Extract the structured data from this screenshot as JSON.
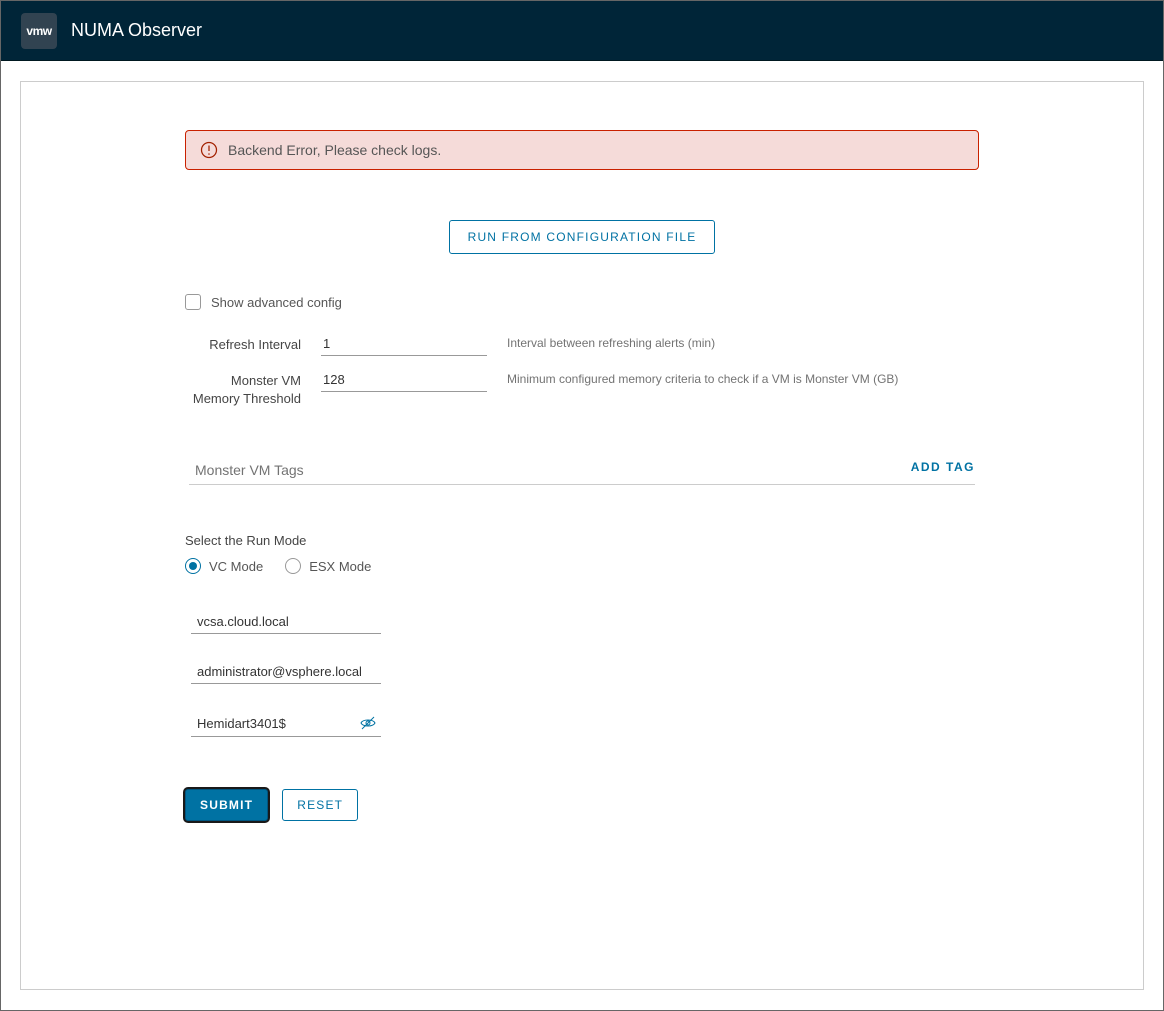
{
  "brand": {
    "logo_text": "vmw",
    "title": "NUMA Observer"
  },
  "alert": {
    "message": "Backend Error, Please check logs."
  },
  "actions": {
    "run_config": "RUN FROM CONFIGURATION FILE",
    "add_tag": "ADD TAG",
    "submit": "SUBMIT",
    "reset": "RESET"
  },
  "form": {
    "advanced_checkbox_label": "Show advanced config",
    "advanced_checked": false,
    "refresh": {
      "label": "Refresh Interval",
      "value": "1",
      "hint": "Interval between refreshing alerts (min)"
    },
    "threshold": {
      "label": "Monster VM Memory Threshold",
      "value": "128",
      "hint": "Minimum configured memory criteria to check if a VM is Monster VM (GB)"
    },
    "tags_section_title": "Monster VM Tags",
    "runmode": {
      "title": "Select the Run Mode",
      "options": [
        {
          "label": "VC Mode",
          "selected": true
        },
        {
          "label": "ESX Mode",
          "selected": false
        }
      ]
    },
    "credentials": {
      "host": "vcsa.cloud.local",
      "username": "administrator@vsphere.local",
      "password": "Hemidart3401$"
    }
  }
}
